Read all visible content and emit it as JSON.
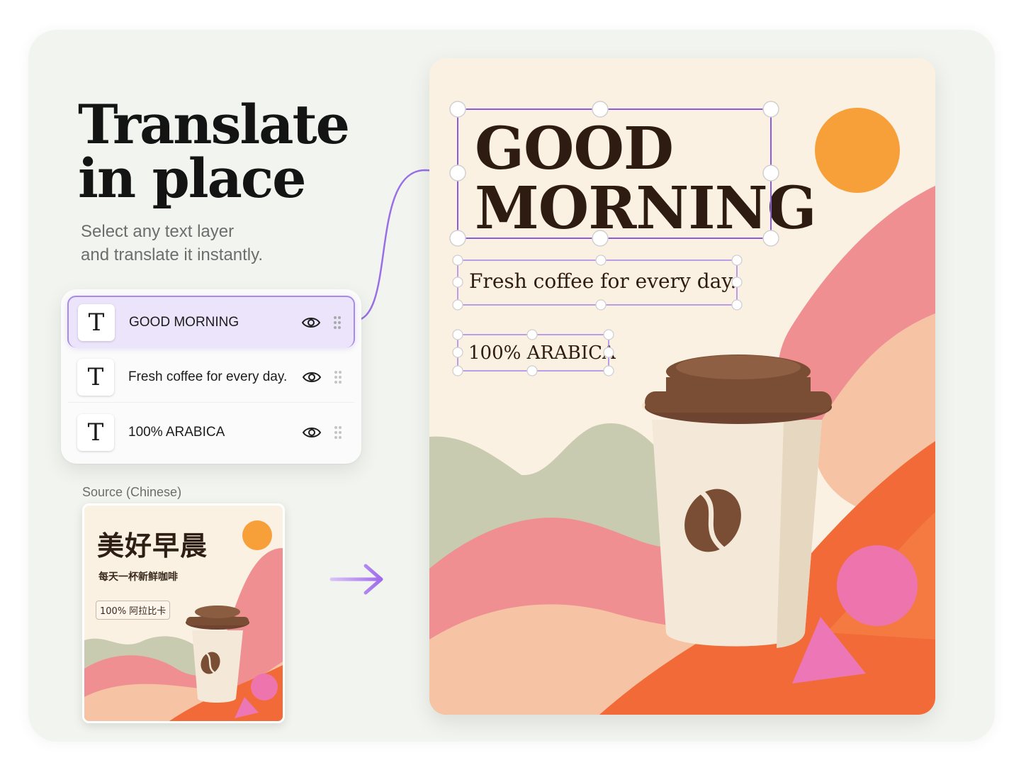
{
  "headline": {
    "line1": "Translate",
    "line2": "in place"
  },
  "subtitle": {
    "line1": "Select any text layer",
    "line2": "and translate it instantly."
  },
  "layers": [
    {
      "icon_letter": "T",
      "label": "GOOD MORNING",
      "selected": true
    },
    {
      "icon_letter": "T",
      "label": "Fresh coffee for every day.",
      "selected": false
    },
    {
      "icon_letter": "T",
      "label": "100% ARABICA",
      "selected": false
    }
  ],
  "source": {
    "caption": "Source (Chinese)",
    "title": "美好早晨",
    "tagline": "每天一杯新鲜咖啡",
    "badge": "100% 阿拉比卡"
  },
  "poster": {
    "headline_line1": "GOOD",
    "headline_line2": "MORNING",
    "tagline": "Fresh coffee for every day.",
    "badge": "100% ARABICA"
  },
  "colors": {
    "accent": "#8a5cdb",
    "selection": "#9b7ae0",
    "sun": "#f7a03a",
    "pink": "#ef8f92",
    "orange": "#f26a37",
    "sage": "#c9cbb0",
    "cup_lid": "#7a4e34"
  },
  "icons": {
    "visibility": "eye-icon",
    "reorder": "drag-handle-icon",
    "flow": "arrow-right-icon"
  }
}
